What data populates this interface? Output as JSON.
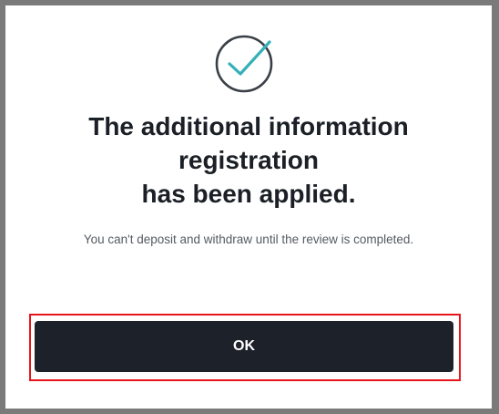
{
  "dialog": {
    "icon": "check-circle-icon",
    "title_lines": [
      "The additional information",
      "registration",
      "has been applied."
    ],
    "message": "You can't deposit and withdraw until the review is completed.",
    "ok_label": "OK"
  },
  "colors": {
    "icon_circle": "#3a3f47",
    "icon_check": "#35b0b8",
    "button_bg": "#1d212a",
    "highlight": "#e8141c"
  }
}
